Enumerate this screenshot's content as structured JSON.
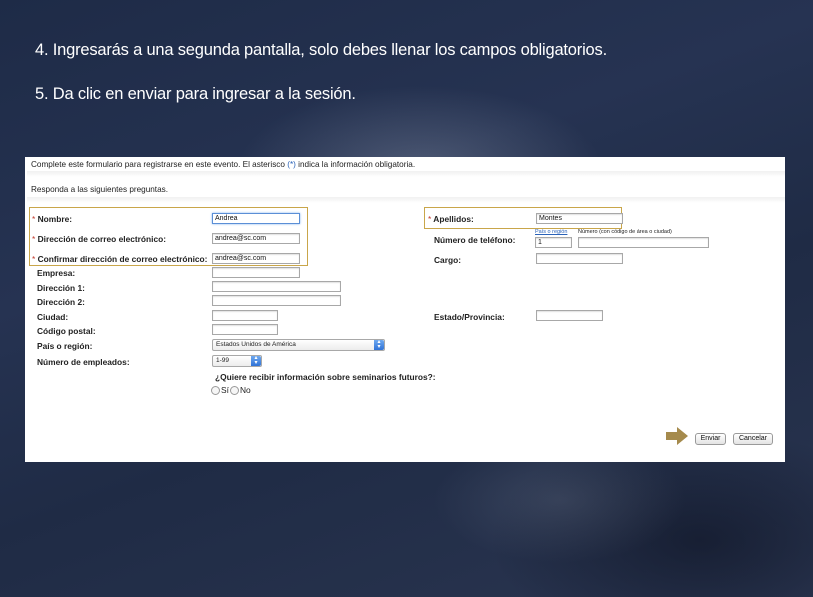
{
  "instructions": {
    "step4": "4. Ingresarás a una segunda pantalla, solo debes llenar los campos obligatorios.",
    "step5": "5. Da clic en enviar para ingresar a la sesión."
  },
  "form": {
    "intro": "Complete este formulario para registrarse en este evento. El asterisco",
    "intro_star": "(*)",
    "intro_end": "indica la información obligatoria.",
    "prompt": "Responda a las siguientes preguntas.",
    "required_mark": "*",
    "labels": {
      "nombre": "Nombre:",
      "email": "Dirección de correo electrónico:",
      "confirm_email": "Confirmar dirección de correo electrónico:",
      "empresa": "Empresa:",
      "direccion1": "Dirección 1:",
      "direccion2": "Dirección 2:",
      "ciudad": "Ciudad:",
      "codigo_postal": "Código postal:",
      "pais": "País o región:",
      "empleados": "Número de empleados:",
      "apellidos": "Apellidos:",
      "telefono": "Número de teléfono:",
      "cargo": "Cargo:",
      "estado": "Estado/Provincia:"
    },
    "values": {
      "nombre": "Andrea",
      "email": "andrea@sc.com",
      "confirm_email": "andrea@sc.com",
      "apellidos": "Montes",
      "phone_country": "1",
      "pais": "Estados Unidos de América",
      "empleados": "1-99"
    },
    "phone_hint_region": "País o región",
    "phone_hint_number": "Número (con código de área o ciudad)",
    "seminar_question": "¿Quiere recibir información sobre seminarios futuros?:",
    "radio_yes": "Sí",
    "radio_no": "No",
    "submit_label": "Enviar",
    "cancel_label": "Cancelar"
  },
  "colors": {
    "highlight_border": "#c9a64a",
    "arrow": "#a58a4c",
    "required_star": "#c0392b",
    "background": "#1e2b47"
  }
}
